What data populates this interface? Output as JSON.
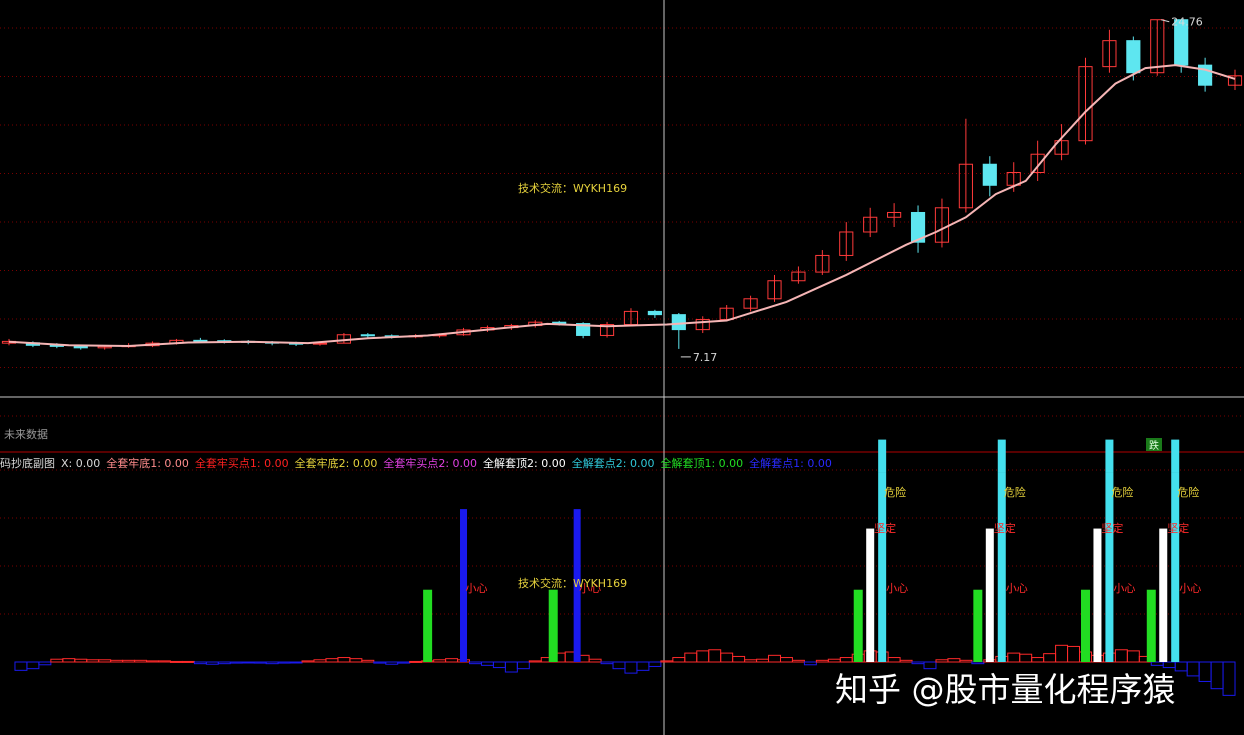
{
  "colors": {
    "up": "#ff3a3a",
    "down": "#5ee6f0",
    "ma": "#f5b5b5",
    "grid": "#7a0000",
    "crosshair": "#c8c8c8",
    "bar_green": "#22dd22",
    "bar_blue": "#1a1aee",
    "bar_white": "#ffffff",
    "bar_cyan": "#44e0ee",
    "label_yellow": "#e6d23c",
    "label_red": "#ff2a2a"
  },
  "main_panel": {
    "watermark": "技术交流：WYKH169",
    "no_data_label": "未来数据",
    "high_marker": "24.76",
    "low_marker": "7.17",
    "fall_badge": "跌"
  },
  "sub_panel": {
    "title": "码抄底副图",
    "indicators": [
      {
        "label": "X: 0.00",
        "color": "#d8d8d8"
      },
      {
        "label": "全套牢底1: 0.00",
        "color": "#ff8c8c"
      },
      {
        "label": "全套牢买点1: 0.00",
        "color": "#ff2020"
      },
      {
        "label": "全套牢底2: 0.00",
        "color": "#e6d23c"
      },
      {
        "label": "全套牢买点2: 0.00",
        "color": "#e040e0"
      },
      {
        "label": "全解套顶2: 0.00",
        "color": "#ffffff"
      },
      {
        "label": "全解套点2: 0.00",
        "color": "#30c8d8"
      },
      {
        "label": "全解套顶1: 0.00",
        "color": "#22dd22"
      },
      {
        "label": "全解套点1: 0.00",
        "color": "#2a2aff"
      }
    ],
    "watermark": "技术交流：WYKH169",
    "signal_labels": {
      "careful": "小心",
      "danger": "危险",
      "firm": "坚定"
    }
  },
  "footer_watermark": "知乎 @股市量化程序猿",
  "chart_data": [
    {
      "type": "candlestick",
      "title": "",
      "xlabel": "",
      "ylabel": "",
      "ylim": [
        6.5,
        26
      ],
      "log_scale": true,
      "grid": true,
      "n_bars": 206,
      "series": [
        {
          "name": "",
          "kind": "candles",
          "points": [
            [
              0,
              9.06,
              9.11,
              9.18,
              9.0
            ],
            [
              4,
              9.07,
              9.0,
              9.11,
              8.95
            ],
            [
              8,
              9.0,
              8.97,
              9.06,
              8.92
            ],
            [
              12,
              8.97,
              8.93,
              9.0,
              8.88
            ],
            [
              16,
              8.93,
              8.97,
              9.0,
              8.88
            ],
            [
              20,
              8.97,
              8.99,
              9.06,
              8.93
            ],
            [
              24,
              8.99,
              9.06,
              9.11,
              8.95
            ],
            [
              28,
              9.06,
              9.14,
              9.18,
              9.02
            ],
            [
              32,
              9.14,
              9.13,
              9.21,
              9.07
            ],
            [
              36,
              9.13,
              9.11,
              9.17,
              9.05
            ],
            [
              40,
              9.11,
              9.09,
              9.15,
              9.03
            ],
            [
              44,
              9.09,
              9.06,
              9.12,
              9.0
            ],
            [
              48,
              9.06,
              9.04,
              9.1,
              8.98
            ],
            [
              52,
              9.04,
              9.06,
              9.11,
              8.99
            ],
            [
              56,
              9.06,
              9.3,
              9.35,
              9.05
            ],
            [
              60,
              9.3,
              9.27,
              9.35,
              9.2
            ],
            [
              64,
              9.27,
              9.25,
              9.31,
              9.19
            ],
            [
              68,
              9.25,
              9.27,
              9.32,
              9.2
            ],
            [
              72,
              9.27,
              9.3,
              9.34,
              9.22
            ],
            [
              76,
              9.3,
              9.44,
              9.5,
              9.27
            ],
            [
              80,
              9.44,
              9.51,
              9.57,
              9.38
            ],
            [
              84,
              9.51,
              9.57,
              9.62,
              9.44
            ],
            [
              88,
              9.57,
              9.67,
              9.73,
              9.51
            ],
            [
              92,
              9.67,
              9.63,
              9.71,
              9.57
            ],
            [
              96,
              9.63,
              9.28,
              9.67,
              9.2
            ],
            [
              100,
              9.28,
              9.6,
              9.68,
              9.22
            ],
            [
              104,
              9.6,
              10.0,
              10.1,
              9.57
            ],
            [
              108,
              10.0,
              9.9,
              10.05,
              9.8
            ],
            [
              112,
              9.9,
              9.45,
              9.95,
              8.9
            ],
            [
              116,
              9.45,
              9.75,
              9.85,
              9.35
            ],
            [
              120,
              9.75,
              10.1,
              10.2,
              9.7
            ],
            [
              124,
              10.1,
              10.4,
              10.5,
              10.0
            ],
            [
              128,
              10.4,
              11.0,
              11.2,
              10.3
            ],
            [
              132,
              11.0,
              11.3,
              11.5,
              10.9
            ],
            [
              136,
              11.3,
              11.9,
              12.1,
              11.2
            ],
            [
              140,
              11.9,
              12.8,
              13.2,
              11.7
            ],
            [
              144,
              12.8,
              13.4,
              13.8,
              12.6
            ],
            [
              148,
              13.4,
              13.6,
              14.0,
              13.0
            ],
            [
              152,
              13.6,
              12.4,
              13.9,
              12.0
            ],
            [
              156,
              12.4,
              13.8,
              14.2,
              12.2
            ],
            [
              160,
              13.8,
              15.8,
              18.2,
              13.6
            ],
            [
              164,
              15.8,
              14.8,
              16.2,
              14.3
            ],
            [
              168,
              14.8,
              15.4,
              15.9,
              14.5
            ],
            [
              172,
              15.4,
              16.3,
              17.0,
              15.0
            ],
            [
              176,
              16.3,
              17.0,
              17.9,
              16.0
            ],
            [
              180,
              17.0,
              21.4,
              22.0,
              16.8
            ],
            [
              184,
              21.4,
              23.2,
              24.0,
              21.0
            ],
            [
              188,
              23.2,
              21.0,
              23.5,
              20.5
            ],
            [
              192,
              21.0,
              24.76,
              24.76,
              20.8
            ],
            [
              196,
              24.76,
              21.5,
              24.0,
              21.0
            ],
            [
              200,
              21.5,
              20.2,
              22.0,
              19.8
            ],
            [
              205,
              20.2,
              20.8,
              21.2,
              19.9
            ]
          ]
        },
        {
          "name": "",
          "kind": "moving_average",
          "points": [
            [
              0,
              9.1
            ],
            [
              10,
              9.0
            ],
            [
              20,
              8.98
            ],
            [
              30,
              9.08
            ],
            [
              40,
              9.1
            ],
            [
              50,
              9.06
            ],
            [
              60,
              9.2
            ],
            [
              70,
              9.28
            ],
            [
              80,
              9.45
            ],
            [
              90,
              9.62
            ],
            [
              100,
              9.55
            ],
            [
              110,
              9.6
            ],
            [
              120,
              9.72
            ],
            [
              130,
              10.3
            ],
            [
              140,
              11.2
            ],
            [
              150,
              12.3
            ],
            [
              155,
              12.8
            ],
            [
              160,
              13.4
            ],
            [
              165,
              14.4
            ],
            [
              170,
              15.0
            ],
            [
              175,
              16.8
            ],
            [
              180,
              18.6
            ],
            [
              185,
              20.3
            ],
            [
              190,
              21.3
            ],
            [
              195,
              21.5
            ],
            [
              200,
              21.2
            ],
            [
              205,
              20.6
            ]
          ]
        }
      ]
    },
    {
      "type": "bar",
      "title": "码抄底副图",
      "xlabel": "",
      "ylabel": "",
      "x_range": [
        0,
        205
      ],
      "ylim": [
        -8,
        40
      ],
      "grid": true,
      "series": [
        {
          "name": "X",
          "color": "#ff2a2a",
          "x": [
            2,
            4,
            6,
            8,
            10,
            12,
            14,
            16,
            18,
            20,
            22,
            24,
            26,
            28,
            30,
            32,
            34,
            36,
            38,
            40,
            42,
            44,
            46,
            48,
            50,
            52,
            54,
            56,
            58,
            60,
            62,
            64,
            66,
            68,
            70,
            72,
            74,
            76,
            78,
            80,
            82,
            84,
            86,
            88,
            90,
            92,
            94,
            96,
            98,
            100,
            102,
            104,
            106,
            108,
            110,
            112,
            114,
            116,
            118,
            120,
            122,
            124,
            126,
            128,
            130,
            132,
            134,
            136,
            138,
            140,
            142,
            144,
            146,
            148,
            150,
            152,
            154,
            156,
            158,
            160,
            162,
            164,
            166,
            168,
            170,
            172,
            174,
            176,
            178,
            180,
            182,
            184,
            186,
            188,
            190,
            192,
            194,
            196,
            198,
            200,
            202,
            204
          ],
          "values": [
            -1.5,
            -1.2,
            -0.5,
            0.5,
            0.6,
            0.5,
            0.4,
            0.4,
            0.3,
            0.3,
            0.3,
            0.2,
            0.2,
            0.1,
            0.1,
            -0.3,
            -0.4,
            -0.3,
            -0.2,
            -0.1,
            -0.2,
            -0.3,
            -0.2,
            -0.1,
            0.2,
            0.4,
            0.6,
            0.8,
            0.6,
            0.3,
            -0.2,
            -0.4,
            -0.2,
            0.1,
            0.2,
            0.4,
            0.6,
            0.4,
            -0.3,
            -0.6,
            -1.0,
            -1.8,
            -1.2,
            0.2,
            0.8,
            1.6,
            1.8,
            1.2,
            0.5,
            -0.3,
            -1.2,
            -2.0,
            -1.5,
            -0.8,
            0.2,
            0.8,
            1.6,
            2.0,
            2.2,
            1.6,
            1.0,
            0.4,
            0.5,
            1.2,
            0.8,
            0.3,
            -0.5,
            0.3,
            0.5,
            0.8,
            1.4,
            2.0,
            1.8,
            0.8,
            0.3,
            -0.3,
            -1.2,
            0.4,
            0.6,
            0.3,
            -0.3,
            0.4,
            1.0,
            1.6,
            1.4,
            0.8,
            1.5,
            3.0,
            2.8,
            1.8,
            1.2,
            1.6,
            2.2,
            2.0,
            1.0,
            -0.6,
            -1.0,
            -1.6,
            -2.5,
            -3.5,
            -4.8,
            -6.0
          ]
        },
        {
          "name": "全解套顶1",
          "color": "#22dd22",
          "x": [
            70,
            91,
            142,
            162,
            180,
            191
          ],
          "values": [
            13,
            13,
            13,
            13,
            13,
            13
          ]
        },
        {
          "name": "全解套点1",
          "color": "#1a1aee",
          "x": [
            76,
            95,
            146,
            166,
            184,
            195
          ],
          "values": [
            27.5,
            27.5,
            34,
            34,
            34,
            34
          ]
        },
        {
          "name": "全解套顶2",
          "color": "#ffffff",
          "x": [
            144,
            164,
            182,
            193
          ],
          "values": [
            24,
            24,
            24,
            24
          ]
        },
        {
          "name": "全解套点2",
          "color": "#44e0ee",
          "x": [
            146,
            166,
            184,
            195
          ],
          "values": [
            34,
            34,
            34,
            34
          ]
        }
      ]
    }
  ]
}
